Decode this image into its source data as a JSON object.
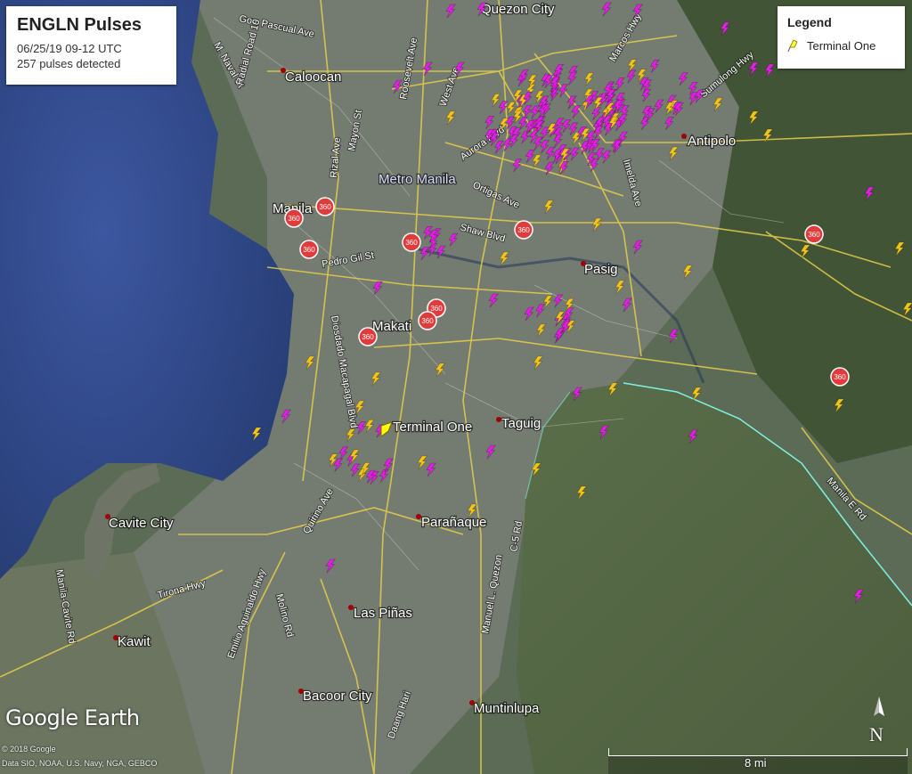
{
  "info": {
    "title": "ENGLN Pulses",
    "date": "06/25/19 09-12 UTC",
    "count": "257 pulses detected"
  },
  "legend": {
    "title": "Legend",
    "item": "Terminal One"
  },
  "branding": {
    "logo": "Google Earth",
    "copyright": "© 2018 Google",
    "data_credit": "Data SIO, NOAA, U.S. Navy, NGA, GEBCO"
  },
  "scale": {
    "label": "8 mi"
  },
  "compass": {
    "label": "N"
  },
  "terminal": {
    "label": "Terminal One"
  },
  "places": [
    {
      "name": "Quezon City"
    },
    {
      "name": "Caloocan"
    },
    {
      "name": "Metro Manila"
    },
    {
      "name": "Manila"
    },
    {
      "name": "Antipolo"
    },
    {
      "name": "Pasig"
    },
    {
      "name": "Makati"
    },
    {
      "name": "Taguig"
    },
    {
      "name": "Parañaque"
    },
    {
      "name": "Cavite City"
    },
    {
      "name": "Las Piñas"
    },
    {
      "name": "Kawit"
    },
    {
      "name": "Bacoor City"
    },
    {
      "name": "Muntinlupa"
    }
  ],
  "roads": [
    {
      "name": "Gov. Pascual Ave"
    },
    {
      "name": "Roosevelt Ave"
    },
    {
      "name": "West Ave"
    },
    {
      "name": "Rizal Ave"
    },
    {
      "name": "Mayon St"
    },
    {
      "name": "Aurora Blvd"
    },
    {
      "name": "Ortigas Ave"
    },
    {
      "name": "Shaw Blvd"
    },
    {
      "name": "Pedro Gil St"
    },
    {
      "name": "Marcos Hwy"
    },
    {
      "name": "Sumulong Hwy"
    },
    {
      "name": "Imelda Ave"
    },
    {
      "name": "Manila E Rd"
    },
    {
      "name": "Manila-Cavite Rd"
    },
    {
      "name": "Tirona Hwy"
    },
    {
      "name": "Emilio Aguinaldo Hwy"
    },
    {
      "name": "Molino Rd"
    },
    {
      "name": "Daang Hari"
    },
    {
      "name": "Quirino Ave"
    },
    {
      "name": "Diosdado Macapagal Blvd"
    },
    {
      "name": "Manuel L. Quezon"
    },
    {
      "name": "C-5 Rd"
    },
    {
      "name": "M. Naval St"
    },
    {
      "name": "Radial Road 10"
    }
  ],
  "markers": {
    "panorama_label": "360"
  },
  "colors": {
    "cluster_pulse": "#e020e0",
    "terminal_pulse": "#f2c418",
    "terminal_marker": "#ffff00",
    "road": "#e6cf4a",
    "water": "#2f4a86",
    "coast": "#7ff0e0"
  },
  "pulse_summary": {
    "cluster": "magenta",
    "terminal_one": "yellow"
  }
}
